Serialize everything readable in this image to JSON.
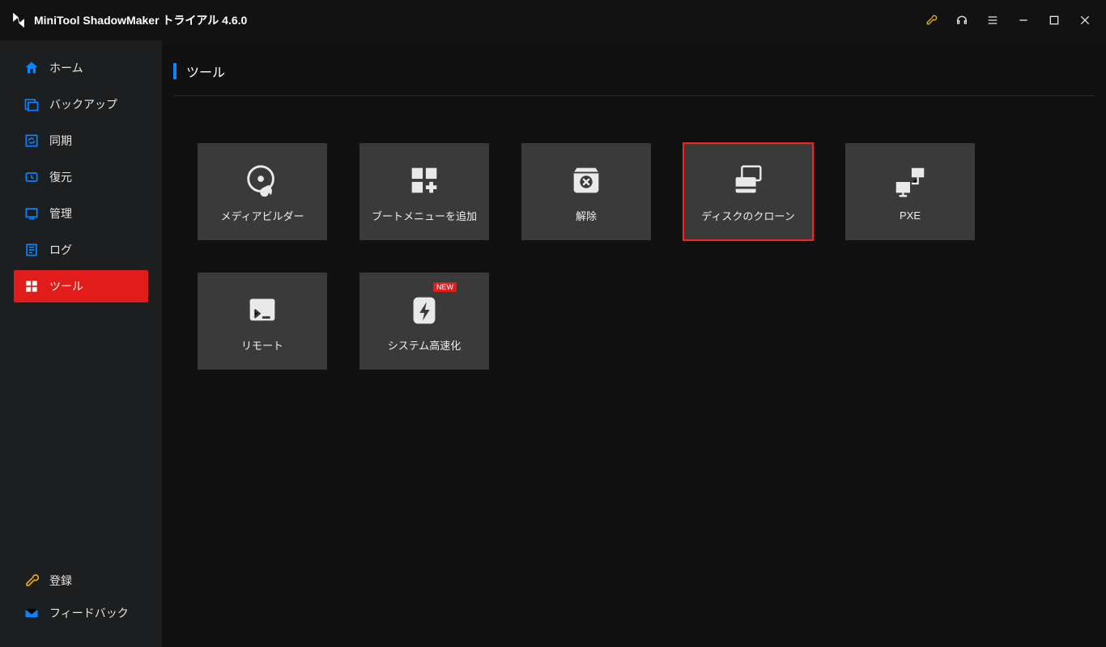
{
  "app": {
    "title": "MiniTool ShadowMaker トライアル 4.6.0"
  },
  "titlebar_icons": [
    "key",
    "headset",
    "menu",
    "minimize",
    "maximize",
    "close"
  ],
  "sidebar": {
    "items": [
      {
        "label": "ホーム",
        "icon": "home"
      },
      {
        "label": "バックアップ",
        "icon": "backup"
      },
      {
        "label": "同期",
        "icon": "sync"
      },
      {
        "label": "復元",
        "icon": "restore"
      },
      {
        "label": "管理",
        "icon": "manage"
      },
      {
        "label": "ログ",
        "icon": "log"
      },
      {
        "label": "ツール",
        "icon": "tools",
        "active": true
      }
    ],
    "bottom": [
      {
        "label": "登録",
        "icon": "key-gold"
      },
      {
        "label": "フィードバック",
        "icon": "mail"
      }
    ]
  },
  "page": {
    "title": "ツール"
  },
  "tools": [
    {
      "label": "メディアビルダー",
      "icon": "disc-fire",
      "highlight": false
    },
    {
      "label": "ブートメニューを追加",
      "icon": "grid-plus",
      "highlight": false
    },
    {
      "label": "解除",
      "icon": "box-x",
      "highlight": false
    },
    {
      "label": "ディスクのクローン",
      "icon": "disk-clone",
      "highlight": true
    },
    {
      "label": "PXE",
      "icon": "network",
      "highlight": false
    },
    {
      "label": "リモート",
      "icon": "terminal",
      "highlight": false
    },
    {
      "label": "システム高速化",
      "icon": "speed",
      "highlight": false,
      "badge": "NEW"
    }
  ]
}
